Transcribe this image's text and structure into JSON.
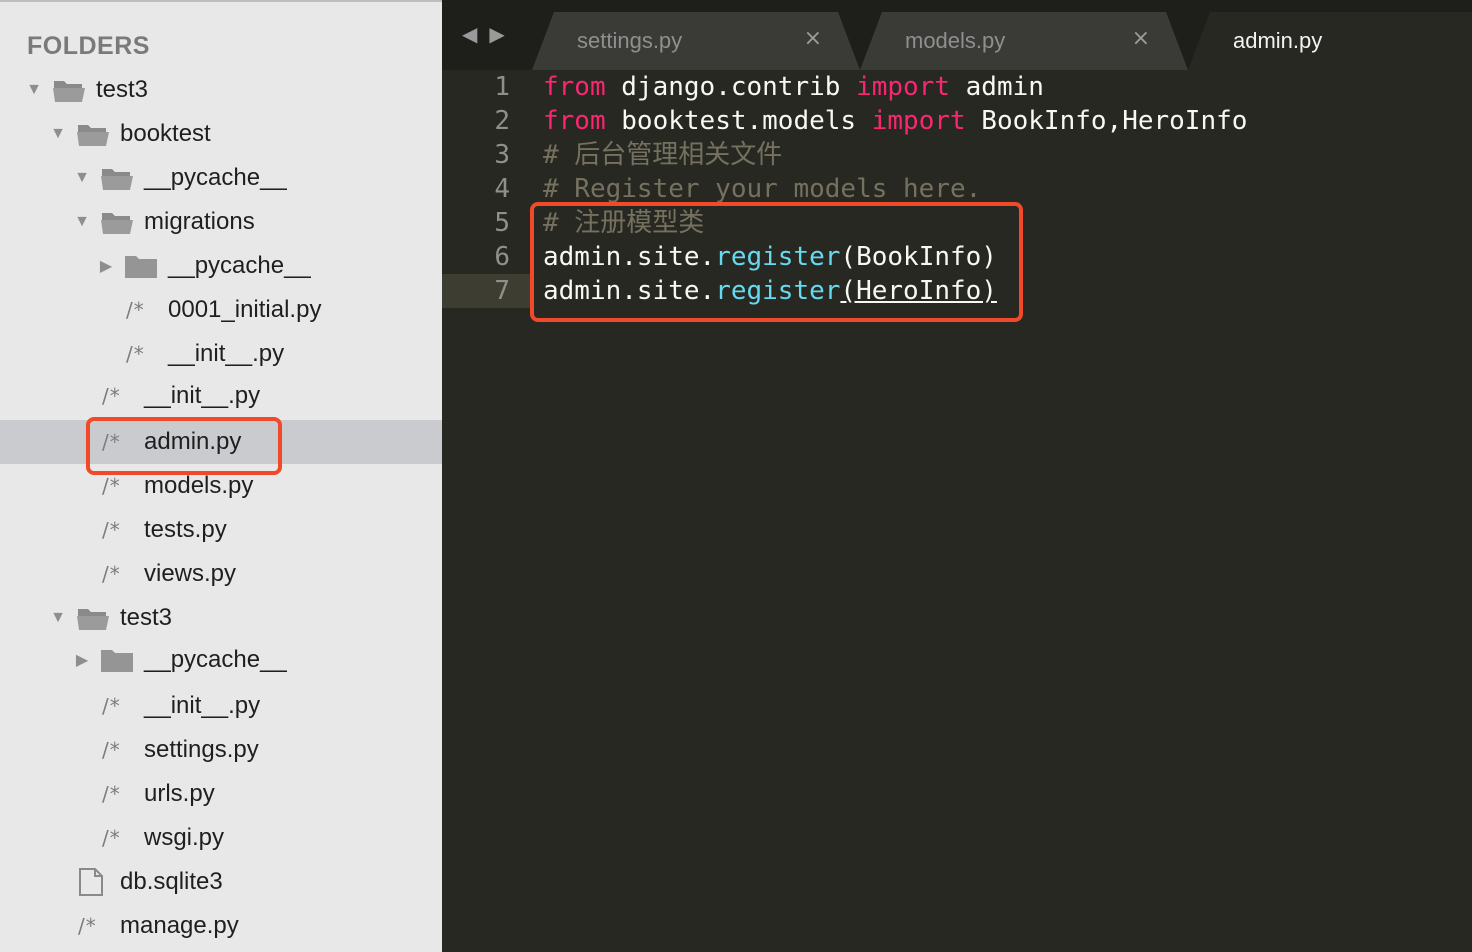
{
  "sidebar": {
    "title": "FOLDERS",
    "items": [
      {
        "label": "test3",
        "type": "folder",
        "expanded": true
      },
      {
        "label": "booktest",
        "type": "folder",
        "expanded": true
      },
      {
        "label": "__pycache__",
        "type": "folder",
        "expanded": true
      },
      {
        "label": "migrations",
        "type": "folder",
        "expanded": true
      },
      {
        "label": "__pycache__",
        "type": "folder",
        "expanded": false
      },
      {
        "label": "0001_initial.py",
        "type": "file"
      },
      {
        "label": "__init__.py",
        "type": "file"
      },
      {
        "label": "__init__.py",
        "type": "file"
      },
      {
        "label": "admin.py",
        "type": "file",
        "selected": true
      },
      {
        "label": "models.py",
        "type": "file"
      },
      {
        "label": "tests.py",
        "type": "file"
      },
      {
        "label": "views.py",
        "type": "file"
      },
      {
        "label": "test3",
        "type": "folder",
        "expanded": true
      },
      {
        "label": "__pycache__",
        "type": "folder",
        "expanded": false
      },
      {
        "label": "__init__.py",
        "type": "file"
      },
      {
        "label": "settings.py",
        "type": "file"
      },
      {
        "label": "urls.py",
        "type": "file"
      },
      {
        "label": "wsgi.py",
        "type": "file"
      },
      {
        "label": "db.sqlite3",
        "type": "doc"
      },
      {
        "label": "manage.py",
        "type": "file"
      }
    ],
    "file_icon": "/*"
  },
  "tabs": [
    {
      "label": "settings.py",
      "active": false
    },
    {
      "label": "models.py",
      "active": false
    },
    {
      "label": "admin.py",
      "active": true
    }
  ],
  "tab_close_glyph": "×",
  "editor": {
    "line_numbers": [
      "1",
      "2",
      "3",
      "4",
      "5",
      "6",
      "7"
    ],
    "current_line": 7
  },
  "code": {
    "l1_a": "from",
    "l1_b": " django.contrib ",
    "l1_c": "import",
    "l1_d": " admin",
    "l2_a": "from",
    "l2_b": " booktest.models ",
    "l2_c": "import",
    "l2_d": " BookInfo,HeroInfo",
    "l3": "# 后台管理相关文件",
    "l4": "# Register your models here.",
    "l5": "# 注册模型类",
    "l6_a": "admin.site.",
    "l6_b": "register",
    "l6_c": "(BookInfo)",
    "l7_a": "admin.site.",
    "l7_b": "register",
    "l7_c": "(HeroInfo)"
  },
  "colors": {
    "keyword": "#f92672",
    "function": "#66d9ef",
    "comment": "#75715e",
    "highlight": "#f04a2a"
  }
}
